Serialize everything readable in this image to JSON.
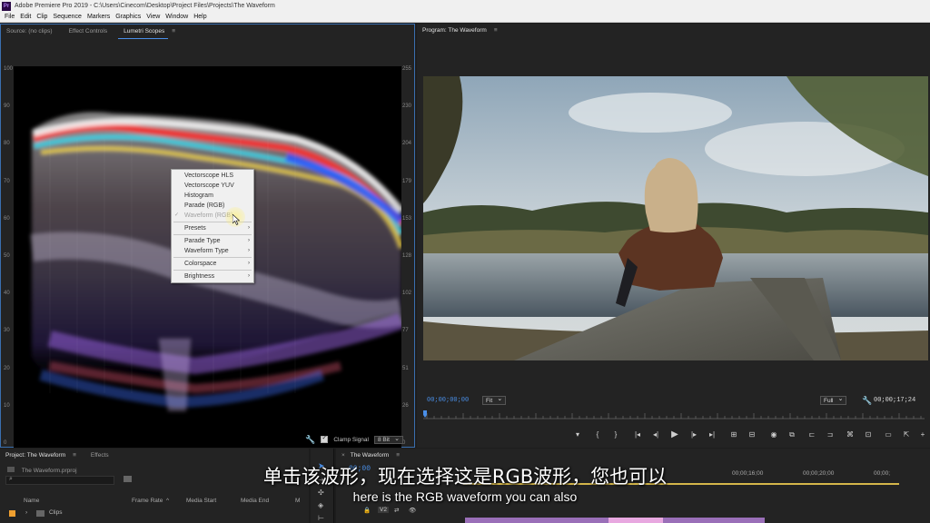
{
  "window": {
    "title": "Adobe Premiere Pro 2019 - C:\\Users\\Cinecom\\Desktop\\Project Files\\Projects\\The Waveform",
    "app_icon_text": "Pr"
  },
  "menu": [
    "File",
    "Edit",
    "Clip",
    "Sequence",
    "Markers",
    "Graphics",
    "View",
    "Window",
    "Help"
  ],
  "source_panel": {
    "tabs": [
      "Source: (no clips)",
      "Effect Controls",
      "Lumetri Scopes"
    ],
    "active_tab": "Lumetri Scopes",
    "ire_ticks": [
      "100",
      "90",
      "80",
      "70",
      "60",
      "50",
      "40",
      "30",
      "20",
      "10",
      "0"
    ],
    "code_ticks": [
      "255",
      "230",
      "204",
      "179",
      "153",
      "128",
      "102",
      "77",
      "51",
      "26",
      "0"
    ],
    "footer": {
      "clamp_signal_label": "Clamp Signal",
      "bit_depth": "8 Bit"
    }
  },
  "context_menu": {
    "items": [
      {
        "label": "Vectorscope HLS"
      },
      {
        "label": "Vectorscope YUV"
      },
      {
        "label": "Histogram"
      },
      {
        "label": "Parade (RGB)"
      },
      {
        "label": "Waveform (RGB)",
        "checked": true,
        "disabled": true
      },
      {
        "sep": true
      },
      {
        "label": "Presets",
        "submenu": true
      },
      {
        "sep": true
      },
      {
        "label": "Parade Type",
        "submenu": true
      },
      {
        "label": "Waveform Type",
        "submenu": true
      },
      {
        "sep": true
      },
      {
        "label": "Colorspace",
        "submenu": true
      },
      {
        "sep": true
      },
      {
        "label": "Brightness",
        "submenu": true
      }
    ]
  },
  "program_panel": {
    "tab": "Program: The Waveform",
    "current_timecode": "00;00;00;00",
    "fit": "Fit",
    "resolution": "Full",
    "duration": "00;00;17;24"
  },
  "project_panel": {
    "tabs": [
      "Project: The Waveform",
      "Effects"
    ],
    "file": "The Waveform.prproj",
    "columns": [
      "Name",
      "Frame Rate",
      "Media Start",
      "Media End",
      "M"
    ],
    "rows": [
      {
        "name": "Clips"
      }
    ]
  },
  "timeline_panel": {
    "tab": "The Waveform",
    "timecode": "00;00",
    "ruler_labels": [
      "00;00;16;00",
      "00;00;20;00",
      "00;00;"
    ],
    "tracks": [
      "V2"
    ]
  },
  "subtitles": {
    "cn": "单击该波形，现在选择这是RGB波形，您也可以",
    "en": "here is the RGB waveform you can also"
  }
}
